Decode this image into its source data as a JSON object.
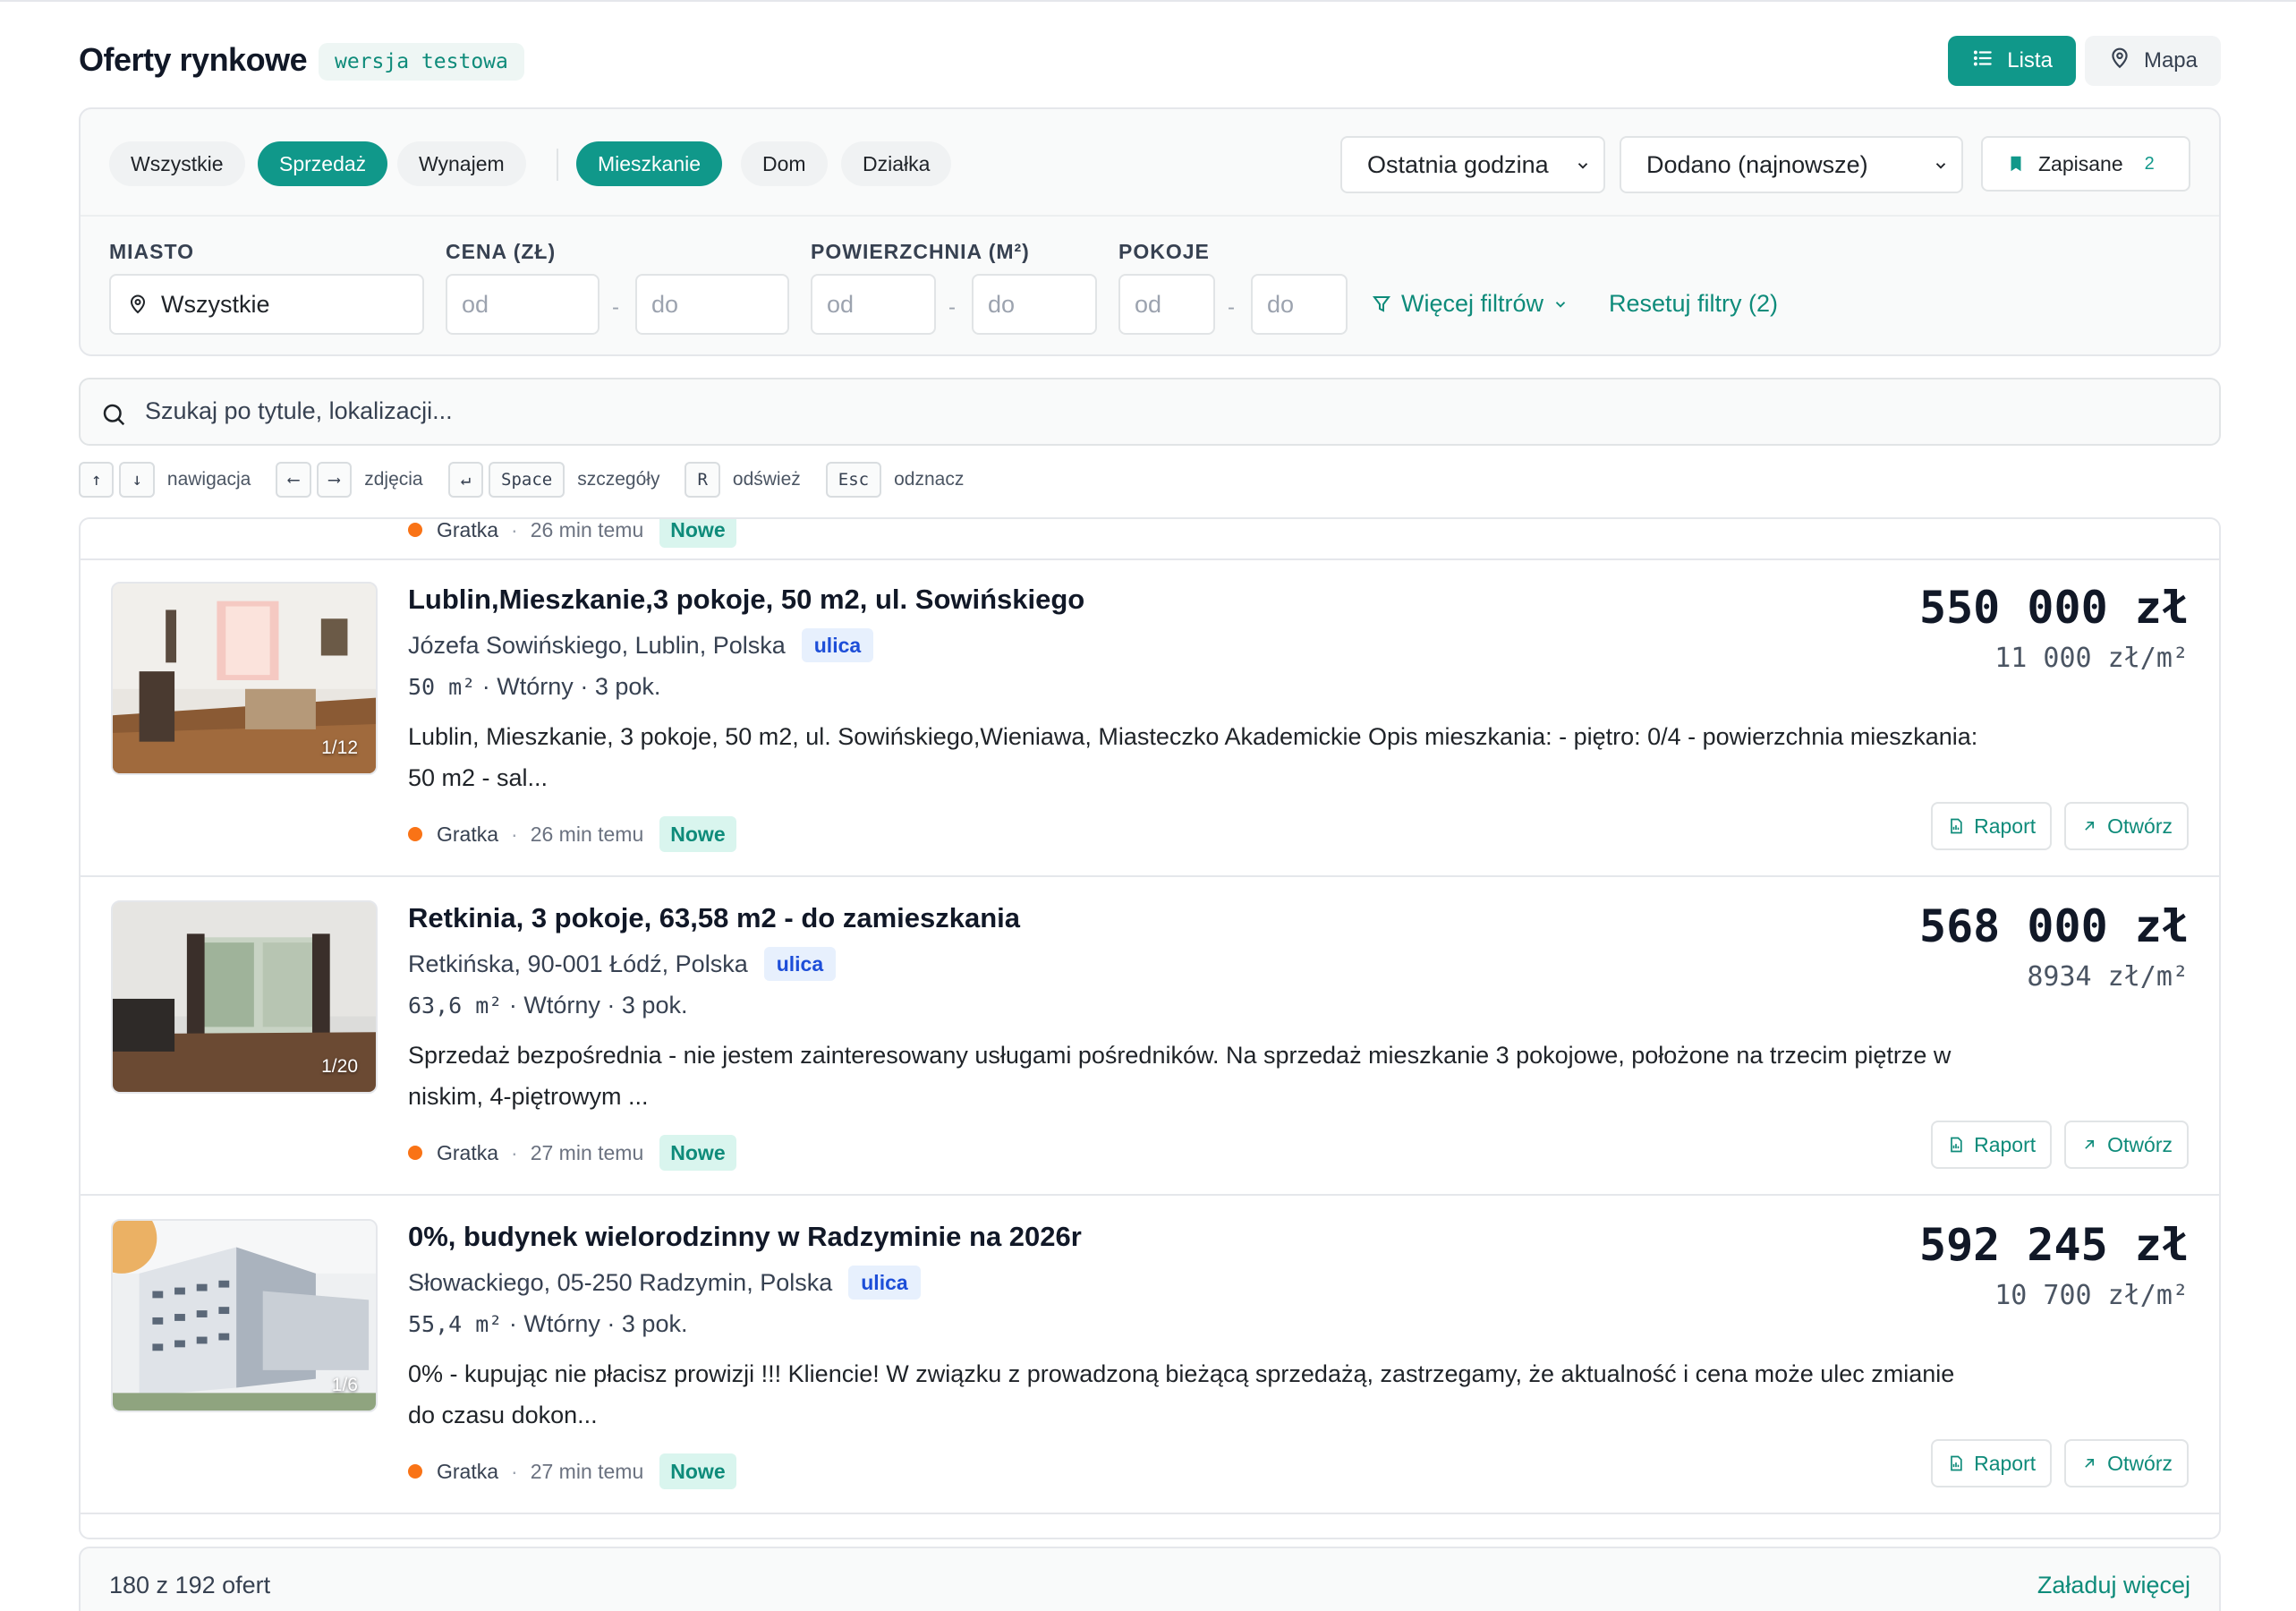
{
  "header": {
    "title": "Oferty rynkowe",
    "badge": "wersja testowa",
    "view_list": "Lista",
    "view_map": "Mapa"
  },
  "filters": {
    "type_pills": [
      "Wszystkie",
      "Sprzedaż",
      "Wynajem"
    ],
    "type_active": "Sprzedaż",
    "property_pills": [
      "Mieszkanie",
      "Dom",
      "Działka"
    ],
    "property_active": "Mieszkanie",
    "time_select": "Ostatnia godzina",
    "sort_select": "Dodano (najnowsze)",
    "saved_label": "Zapisane",
    "saved_count": "2",
    "city_label": "MIASTO",
    "city_value": "Wszystkie",
    "price_label": "CENA (ZŁ)",
    "area_label": "POWIERZCHNIA (M²)",
    "rooms_label": "POKOJE",
    "from_placeholder": "od",
    "to_placeholder": "do",
    "range_dash": "-",
    "more_filters": "Więcej filtrów",
    "reset_filters": "Resetuj filtry (2)"
  },
  "search": {
    "placeholder": "Szukaj po tytule, lokalizacji..."
  },
  "shortcuts": [
    {
      "keys": [
        "↑",
        "↓"
      ],
      "label": "nawigacja"
    },
    {
      "keys": [
        "⟵",
        "⟶"
      ],
      "label": "zdjęcia"
    },
    {
      "keys": [
        "↵",
        "Space"
      ],
      "label": "szczegóły"
    },
    {
      "keys": [
        "R"
      ],
      "label": "odśwież"
    },
    {
      "keys": [
        "Esc"
      ],
      "label": "odznacz"
    }
  ],
  "listings": [
    {
      "title": "Lublin,Mieszkanie,3 pokoje, 50 m2, ul. Sowińskiego",
      "address": "Józefa Sowińskiego, Lublin, Polska",
      "address_tag": "ulica",
      "area": "50 m²",
      "market": "Wtórny",
      "rooms": "3 pok.",
      "description": "Lublin, Mieszkanie, 3 pokoje, 50 m2, ul. Sowińskiego,Wieniawa, Miasteczko Akademickie Opis mieszkania: - piętro: 0/4 - powierzchnia mieszkania: 50 m2 - sal...",
      "source": "Gratka",
      "time": "26 min temu",
      "badge": "Nowe",
      "price": "550 000 zł",
      "price_per_m2": "11 000 zł/m²",
      "photo_counter": "1/12",
      "report": "Raport",
      "open": "Otwórz"
    },
    {
      "title": "Retkinia, 3 pokoje, 63,58 m2 - do zamieszkania",
      "address": "Retkińska, 90-001 Łódź, Polska",
      "address_tag": "ulica",
      "area": "63,6 m²",
      "market": "Wtórny",
      "rooms": "3 pok.",
      "description": "Sprzedaż bezpośrednia - nie jestem zainteresowany usługami pośredników. Na sprzedaż mieszkanie 3 pokojowe, położone na trzecim piętrze w niskim, 4-piętrowym ...",
      "source": "Gratka",
      "time": "27 min temu",
      "badge": "Nowe",
      "price": "568 000 zł",
      "price_per_m2": "8934 zł/m²",
      "photo_counter": "1/20",
      "report": "Raport",
      "open": "Otwórz"
    },
    {
      "title": "0%, budynek wielorodzinny w Radzyminie na 2026r",
      "address": "Słowackiego, 05-250 Radzymin, Polska",
      "address_tag": "ulica",
      "area": "55,4 m²",
      "market": "Wtórny",
      "rooms": "3 pok.",
      "description": "0% - kupując nie płacisz prowizji !!! Kliencie! W związku z prowadzoną bieżącą sprzedażą, zastrzegamy, że aktualność i cena może ulec zmianie do czasu dokon...",
      "source": "Gratka",
      "time": "27 min temu",
      "badge": "Nowe",
      "price": "592 245 zł",
      "price_per_m2": "10 700 zł/m²",
      "photo_counter": "1/6",
      "report": "Raport",
      "open": "Otwórz"
    }
  ],
  "partial_top": {
    "source": "Gratka",
    "time": "26 min temu",
    "badge": "Nowe"
  },
  "footer": {
    "count": "180 z 192 ofert",
    "load_more": "Załaduj więcej"
  },
  "colors": {
    "accent": "#10988a",
    "source_dot": "#f97316",
    "ulica_tag_bg": "#e7f0fd",
    "new_tag_bg": "#d9f5ee"
  }
}
